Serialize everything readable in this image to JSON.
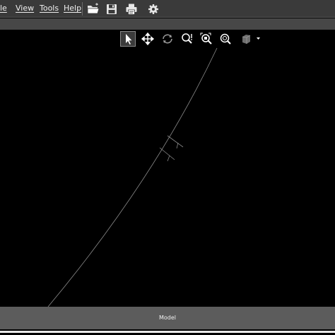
{
  "menu": {
    "items": [
      {
        "label": "le"
      },
      {
        "label": "View"
      },
      {
        "label": "Tools"
      },
      {
        "label": "Help"
      }
    ]
  },
  "toolbar": {
    "icons": [
      "open-folder-icon",
      "save-icon",
      "print-icon",
      "settings-gear-icon"
    ]
  },
  "view_toolbar": {
    "icons": [
      "select-pointer-icon",
      "pan-move-icon",
      "rotate-icon",
      "zoom-window-icon",
      "zoom-extents-icon",
      "zoom-icon",
      "view-cube-icon",
      "dropdown-arrow-icon"
    ],
    "active": "select-pointer-icon"
  },
  "status": {
    "tab_label": "Model"
  },
  "colors": {
    "menubar_bg": "#3a3a3a",
    "canvas_bg": "#000000",
    "statusbar_bg": "#5c5c5c",
    "line": "#8c8c8c"
  }
}
